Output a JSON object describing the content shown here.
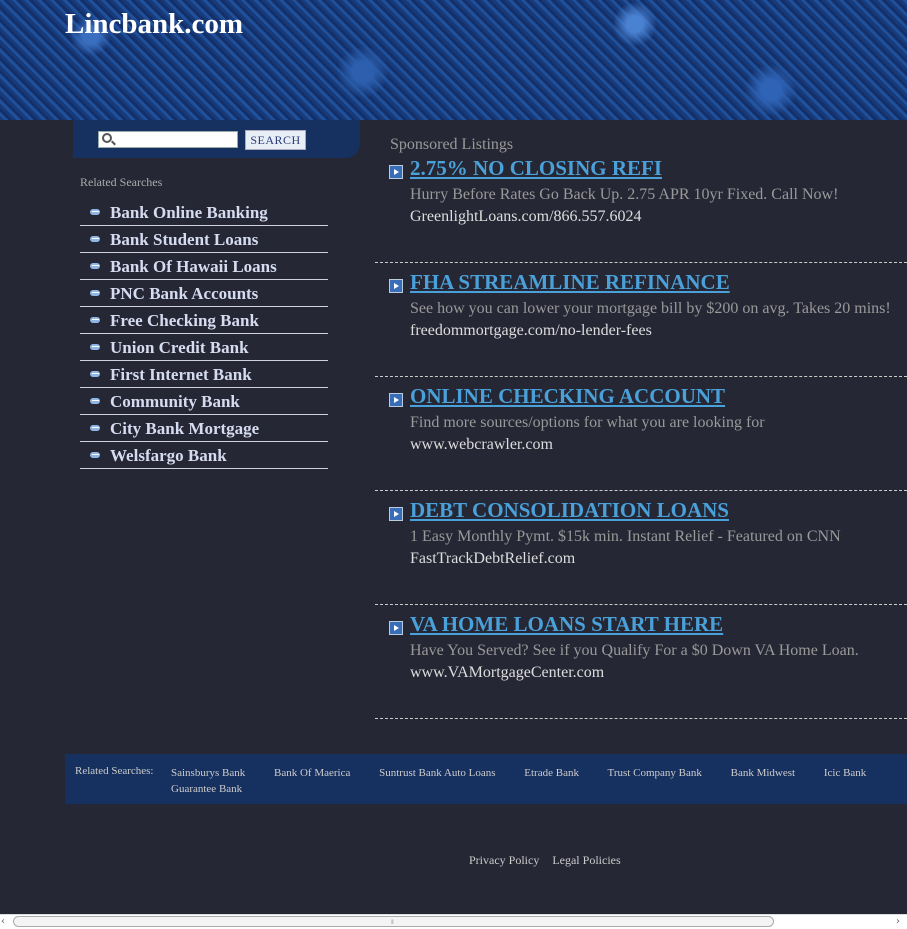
{
  "header": {
    "site_title": "Lincbank.com"
  },
  "search": {
    "placeholder": "",
    "value": "",
    "button_label": "SEARCH"
  },
  "sidebar": {
    "label": "Related Searches",
    "items": [
      "Bank Online Banking",
      "Bank Student Loans",
      "Bank Of Hawaii Loans",
      "PNC Bank Accounts",
      "Free Checking Bank",
      "Union Credit Bank",
      "First Internet Bank",
      "Community Bank",
      "City Bank Mortgage",
      "Welsfargo Bank"
    ]
  },
  "sponsored": {
    "label": "Sponsored Listings",
    "ads": [
      {
        "title": "2.75% NO CLOSING REFI",
        "desc": "Hurry Before Rates Go Back Up. 2.75 APR 10yr Fixed. Call Now!",
        "url": "GreenlightLoans.com/866.557.6024"
      },
      {
        "title": "FHA STREAMLINE REFINANCE",
        "desc": "See how you can lower your mortgage bill by $200 on avg. Takes 20 mins!",
        "url": "freedommortgage.com/no-lender-fees"
      },
      {
        "title": "ONLINE CHECKING ACCOUNT",
        "desc": "Find more sources/options for what you are looking for",
        "url": "www.webcrawler.com"
      },
      {
        "title": "DEBT CONSOLIDATION LOANS",
        "desc": "1 Easy Monthly Pymt. $15k min. Instant Relief - Featured on CNN",
        "url": "FastTrackDebtRelief.com"
      },
      {
        "title": "VA HOME LOANS START HERE",
        "desc": "Have You Served? See if you Qualify For a $0 Down VA Home Loan.",
        "url": "www.VAMortgageCenter.com"
      }
    ]
  },
  "footer": {
    "related_label": "Related Searches:",
    "related_links": [
      "Sainsburys Bank",
      "Bank Of Maerica",
      "Suntrust Bank Auto Loans",
      "Etrade Bank",
      "Trust Company Bank",
      "Bank Midwest",
      "Icic Bank",
      "Guarantee Bank"
    ],
    "legal_links": [
      "Privacy Policy",
      "Legal Policies"
    ]
  },
  "scrollbar": {
    "grip": "⦀"
  }
}
